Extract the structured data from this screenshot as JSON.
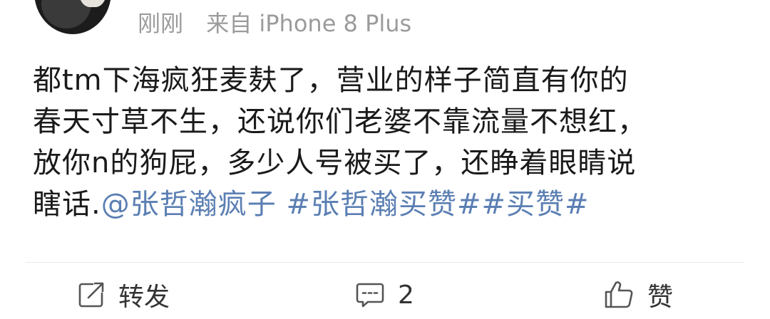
{
  "post": {
    "time": "刚刚",
    "source": "来自 iPhone 8 Plus",
    "content_lines": [
      "都tm下海疯狂麦麸了，营业的样子简直有你的",
      "春天寸草不生，还说你们老婆不靠流量不想红，",
      "放你n的狗屁，多少人号被买了，还睁着眼睛说"
    ],
    "content_tail": "瞎话.",
    "mention": "@张哲瀚疯子",
    "topic1": "#张哲瀚买赞#",
    "topic2": "#买赞#"
  },
  "actions": {
    "repost_label": "转发",
    "comment_count": "2",
    "like_label": "赞"
  },
  "colors": {
    "link": "#5b7fb3",
    "meta": "#9b9b9b",
    "text": "#1a1a1a"
  },
  "icons": {
    "repost": "repost-icon",
    "comment": "comment-icon",
    "like": "thumbs-up-icon"
  }
}
